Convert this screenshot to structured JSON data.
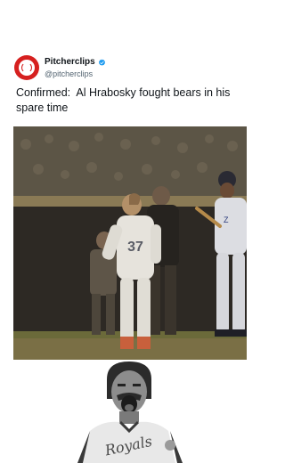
{
  "post": {
    "author": {
      "display_name": "Pitcherclips",
      "handle": "@pitcherclips",
      "verified": true,
      "avatar_icon": "baseball-icon",
      "avatar_color": "#d6201f",
      "verified_color": "#1d9bf0"
    },
    "text": "Confirmed:  Al Hrabosky fought bears in his spare time",
    "media": [
      {
        "kind": "video-still",
        "jersey_number": "37"
      },
      {
        "kind": "photo",
        "jersey_text": "Royals"
      }
    ]
  }
}
